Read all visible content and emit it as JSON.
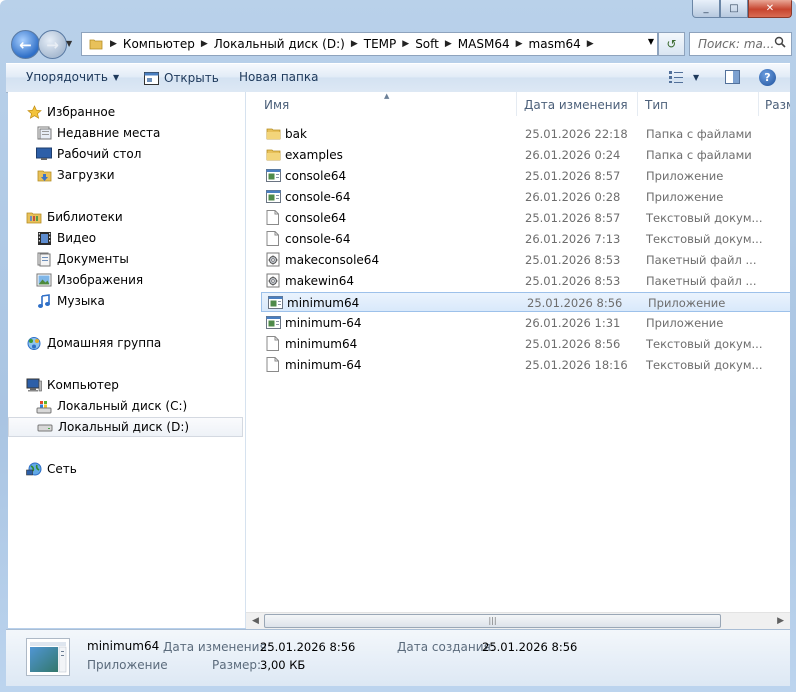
{
  "window": {
    "buttons": {
      "minimize": "_",
      "maximize": "□",
      "close": "✕"
    }
  },
  "address_bar": {
    "crumbs": [
      "Компьютер",
      "Локальный диск (D:)",
      "TEMP",
      "Soft",
      "MASM64",
      "masm64"
    ]
  },
  "search": {
    "placeholder": "Поиск: ma..."
  },
  "toolbar": {
    "organize": "Упорядочить",
    "open": "Открыть",
    "new_folder": "Новая папка"
  },
  "nav": {
    "favorites": {
      "label": "Избранное",
      "items": [
        "Недавние места",
        "Рабочий стол",
        "Загрузки"
      ]
    },
    "libraries": {
      "label": "Библиотеки",
      "items": [
        "Видео",
        "Документы",
        "Изображения",
        "Музыка"
      ]
    },
    "homegroup": {
      "label": "Домашняя группа"
    },
    "computer": {
      "label": "Компьютер",
      "items": [
        "Локальный диск (C:)",
        "Локальный диск (D:)"
      ]
    },
    "network": {
      "label": "Сеть"
    }
  },
  "columns": {
    "name": "Имя",
    "date": "Дата изменения",
    "type": "Тип",
    "size": "Разм"
  },
  "files": [
    {
      "name": "bak",
      "date": "25.01.2026 22:18",
      "type": "Папка с файлами",
      "icon": "folder"
    },
    {
      "name": "examples",
      "date": "26.01.2026 0:24",
      "type": "Папка с файлами",
      "icon": "folder"
    },
    {
      "name": "console64",
      "date": "25.01.2026 8:57",
      "type": "Приложение",
      "icon": "exe"
    },
    {
      "name": "console-64",
      "date": "26.01.2026 0:28",
      "type": "Приложение",
      "icon": "exe"
    },
    {
      "name": "console64",
      "date": "25.01.2026 8:57",
      "type": "Текстовый докум...",
      "icon": "text"
    },
    {
      "name": "console-64",
      "date": "26.01.2026 7:13",
      "type": "Текстовый докум...",
      "icon": "text"
    },
    {
      "name": "makeconsole64",
      "date": "25.01.2026 8:53",
      "type": "Пакетный файл ...",
      "icon": "batch"
    },
    {
      "name": "makewin64",
      "date": "25.01.2026 8:53",
      "type": "Пакетный файл ...",
      "icon": "batch"
    },
    {
      "name": "minimum64",
      "date": "25.01.2026 8:56",
      "type": "Приложение",
      "icon": "exe"
    },
    {
      "name": "minimum-64",
      "date": "26.01.2026 1:31",
      "type": "Приложение",
      "icon": "exe"
    },
    {
      "name": "minimum64",
      "date": "25.01.2026 8:56",
      "type": "Текстовый докум...",
      "icon": "text"
    },
    {
      "name": "minimum-64",
      "date": "25.01.2026 18:16",
      "type": "Текстовый докум...",
      "icon": "text"
    }
  ],
  "selected_index": 8,
  "details": {
    "name": "minimum64",
    "type": "Приложение",
    "modified_label": "Дата изменения:",
    "modified_value": "25.01.2026 8:56",
    "created_label": "Дата создания:",
    "created_value": "25.01.2026 8:56",
    "size_label": "Размер:",
    "size_value": "3,00 КБ"
  }
}
